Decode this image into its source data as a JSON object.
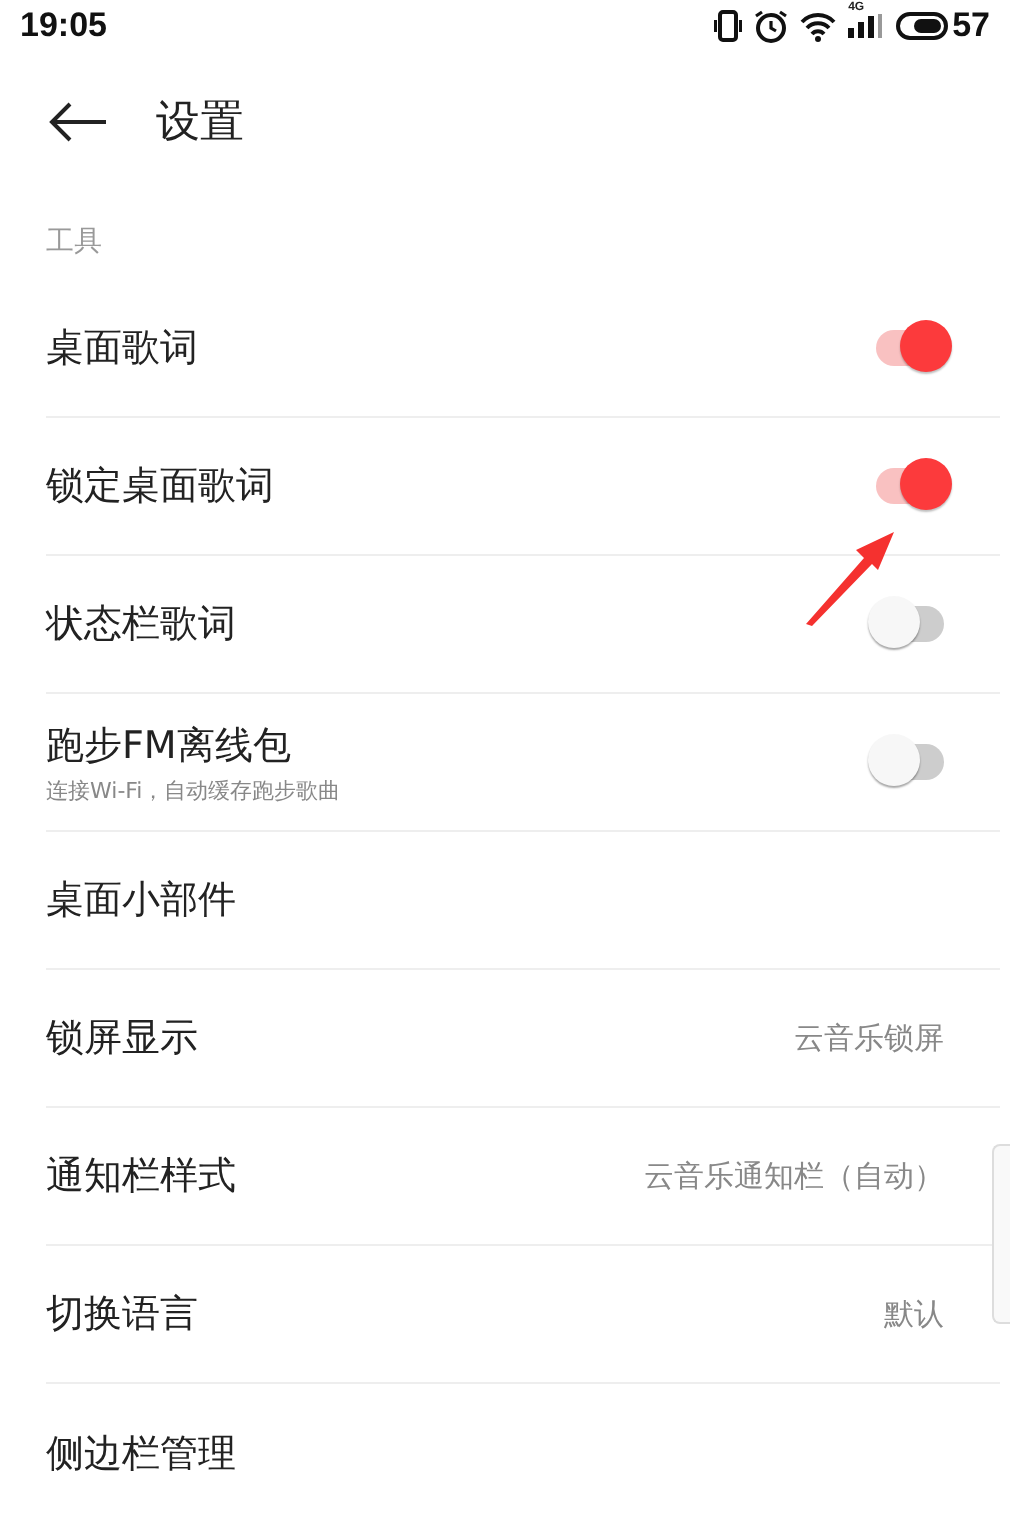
{
  "status_bar": {
    "time": "19:05",
    "network": "4G",
    "battery": "57"
  },
  "title_bar": {
    "title": "设置"
  },
  "section": {
    "label": "工具"
  },
  "rows": [
    {
      "kind": "toggle",
      "label": "桌面歌词",
      "on": true
    },
    {
      "kind": "toggle",
      "label": "锁定桌面歌词",
      "on": true
    },
    {
      "kind": "toggle",
      "label": "状态栏歌词",
      "on": false
    },
    {
      "kind": "toggle",
      "label": "跑步FM离线包",
      "subtitle": "连接Wi-Fi，自动缓存跑步歌曲",
      "on": false
    },
    {
      "kind": "plain",
      "label": "桌面小部件"
    },
    {
      "kind": "value",
      "label": "锁屏显示",
      "value": "云音乐锁屏"
    },
    {
      "kind": "value",
      "label": "通知栏样式",
      "value": "云音乐通知栏（自动）"
    },
    {
      "kind": "value",
      "label": "切换语言",
      "value": "默认"
    },
    {
      "kind": "plain",
      "label": "侧边栏管理"
    }
  ]
}
